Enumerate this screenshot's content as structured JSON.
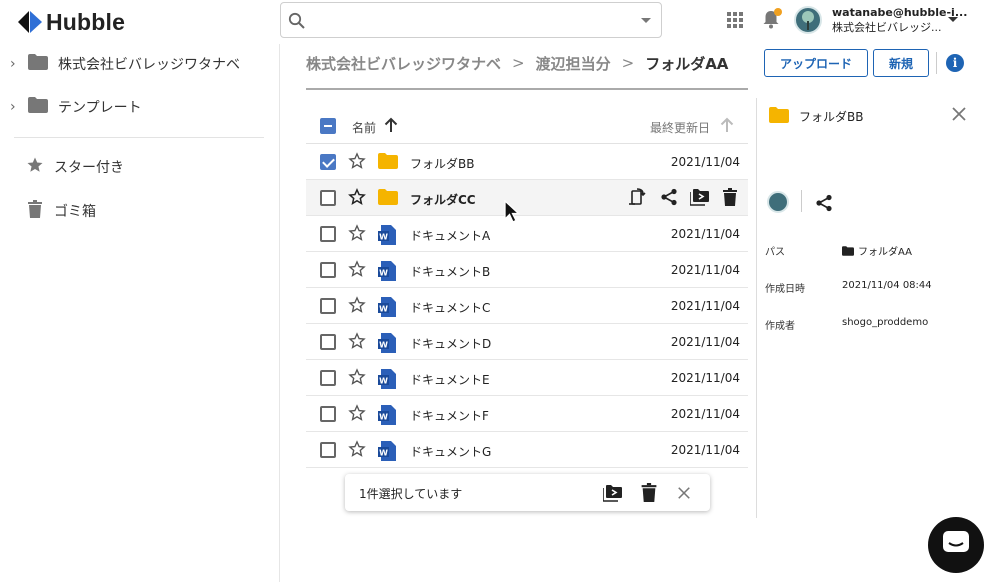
{
  "app": {
    "logo_text": "Hubble"
  },
  "search": {
    "placeholder": "",
    "value": ""
  },
  "account": {
    "email": "watanabe@hubble-i...",
    "company": "株式会社ビバレッジ..."
  },
  "sidebar": {
    "items": [
      {
        "label": "株式会社ビバレッジワタナベ",
        "icon": "folder-icon",
        "expandable": true
      },
      {
        "label": "テンプレート",
        "icon": "folder-icon",
        "expandable": true
      },
      {
        "label": "スター付き",
        "icon": "star-icon"
      },
      {
        "label": "ゴミ箱",
        "icon": "trash-icon"
      }
    ]
  },
  "breadcrumb": {
    "items": [
      "株式会社ビバレッジワタナベ",
      "渡辺担当分",
      "フォルダAA"
    ]
  },
  "toolbar": {
    "upload_label": "アップロード",
    "new_label": "新規"
  },
  "list": {
    "header": {
      "name": "名前",
      "date": "最終更新日"
    },
    "rows": [
      {
        "name": "フォルダBB",
        "type": "folder",
        "date": "2021/11/04",
        "checked": true
      },
      {
        "name": "フォルダCC",
        "type": "folder",
        "date": "",
        "checked": false
      },
      {
        "name": "ドキュメントA",
        "type": "word",
        "date": "2021/11/04",
        "checked": false
      },
      {
        "name": "ドキュメントB",
        "type": "word",
        "date": "2021/11/04",
        "checked": false
      },
      {
        "name": "ドキュメントC",
        "type": "word",
        "date": "2021/11/04",
        "checked": false
      },
      {
        "name": "ドキュメントD",
        "type": "word",
        "date": "2021/11/04",
        "checked": false
      },
      {
        "name": "ドキュメントE",
        "type": "word",
        "date": "2021/11/04",
        "checked": false
      },
      {
        "name": "ドキュメントF",
        "type": "word",
        "date": "2021/11/04",
        "checked": false
      },
      {
        "name": "ドキュメントG",
        "type": "word",
        "date": "2021/11/04",
        "checked": false
      }
    ]
  },
  "details": {
    "title": "フォルダBB",
    "fields": [
      {
        "label": "パス",
        "value": "フォルダAA"
      },
      {
        "label": "作成日時",
        "value": "2021/11/04 08:44"
      },
      {
        "label": "作成者",
        "value": "shogo_proddemo"
      }
    ]
  },
  "selection_bar": {
    "text": "1件選択しています"
  },
  "colors": {
    "accent": "#1e64b4",
    "checkbox": "#4a78c4",
    "folder": "#f5b400",
    "word": "#2b5fb8",
    "notify": "#f0a020"
  }
}
